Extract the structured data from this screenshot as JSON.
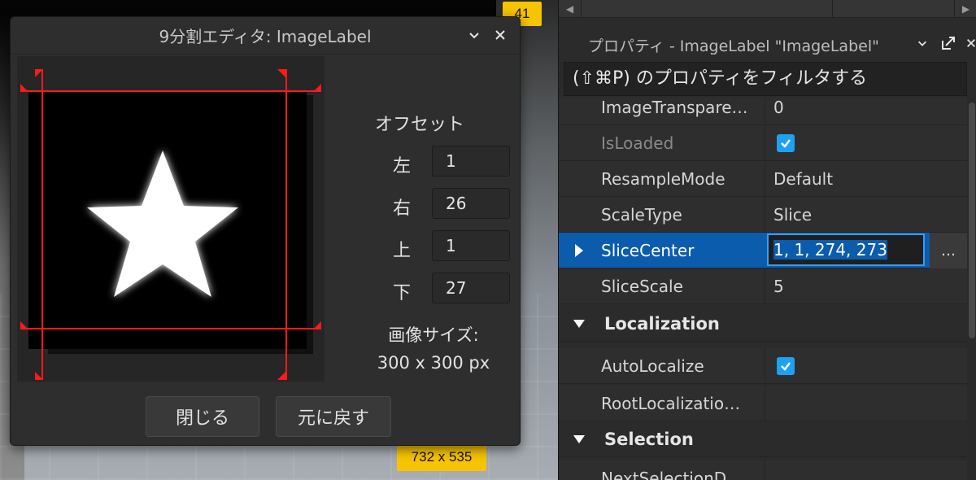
{
  "viewport": {
    "badge_top": "41",
    "badge_size": "732 x 535"
  },
  "dialog": {
    "title": "9分割エディタ: ImageLabel",
    "offsets_title": "オフセット",
    "offsets": [
      {
        "label": "左",
        "value": "1"
      },
      {
        "label": "右",
        "value": "26"
      },
      {
        "label": "上",
        "value": "1"
      },
      {
        "label": "下",
        "value": "27"
      }
    ],
    "image_size_label": "画像サイズ:",
    "image_size_value": "300 x 300 px",
    "close_label": "閉じる",
    "revert_label": "元に戻す",
    "colors": {
      "guide": "#ff1a1a",
      "star": "#ffffff"
    }
  },
  "properties": {
    "title": "プロパティ - ImageLabel \"ImageLabel\"",
    "filter_placeholder": "(⇧⌘P) のプロパティをフィルタする",
    "rows": [
      {
        "name": "ImageTranspare…",
        "value": "0"
      },
      {
        "name": "IsLoaded",
        "value": "true"
      },
      {
        "name": "ResampleMode",
        "value": "Default"
      },
      {
        "name": "ScaleType",
        "value": "Slice"
      },
      {
        "name": "SliceCenter",
        "value": "1, 1, 274, 273"
      },
      {
        "name": "SliceScale",
        "value": "5"
      }
    ],
    "section_localization": "Localization",
    "localization_rows": [
      {
        "name": "AutoLocalize",
        "value": "true"
      },
      {
        "name": "RootLocalizatio…",
        "value": ""
      }
    ],
    "section_selection": "Selection",
    "selection_rows": [
      {
        "name": "NextSelectionD…",
        "value": ""
      }
    ],
    "ellipsis": "…",
    "accent": "#0b5cad"
  }
}
